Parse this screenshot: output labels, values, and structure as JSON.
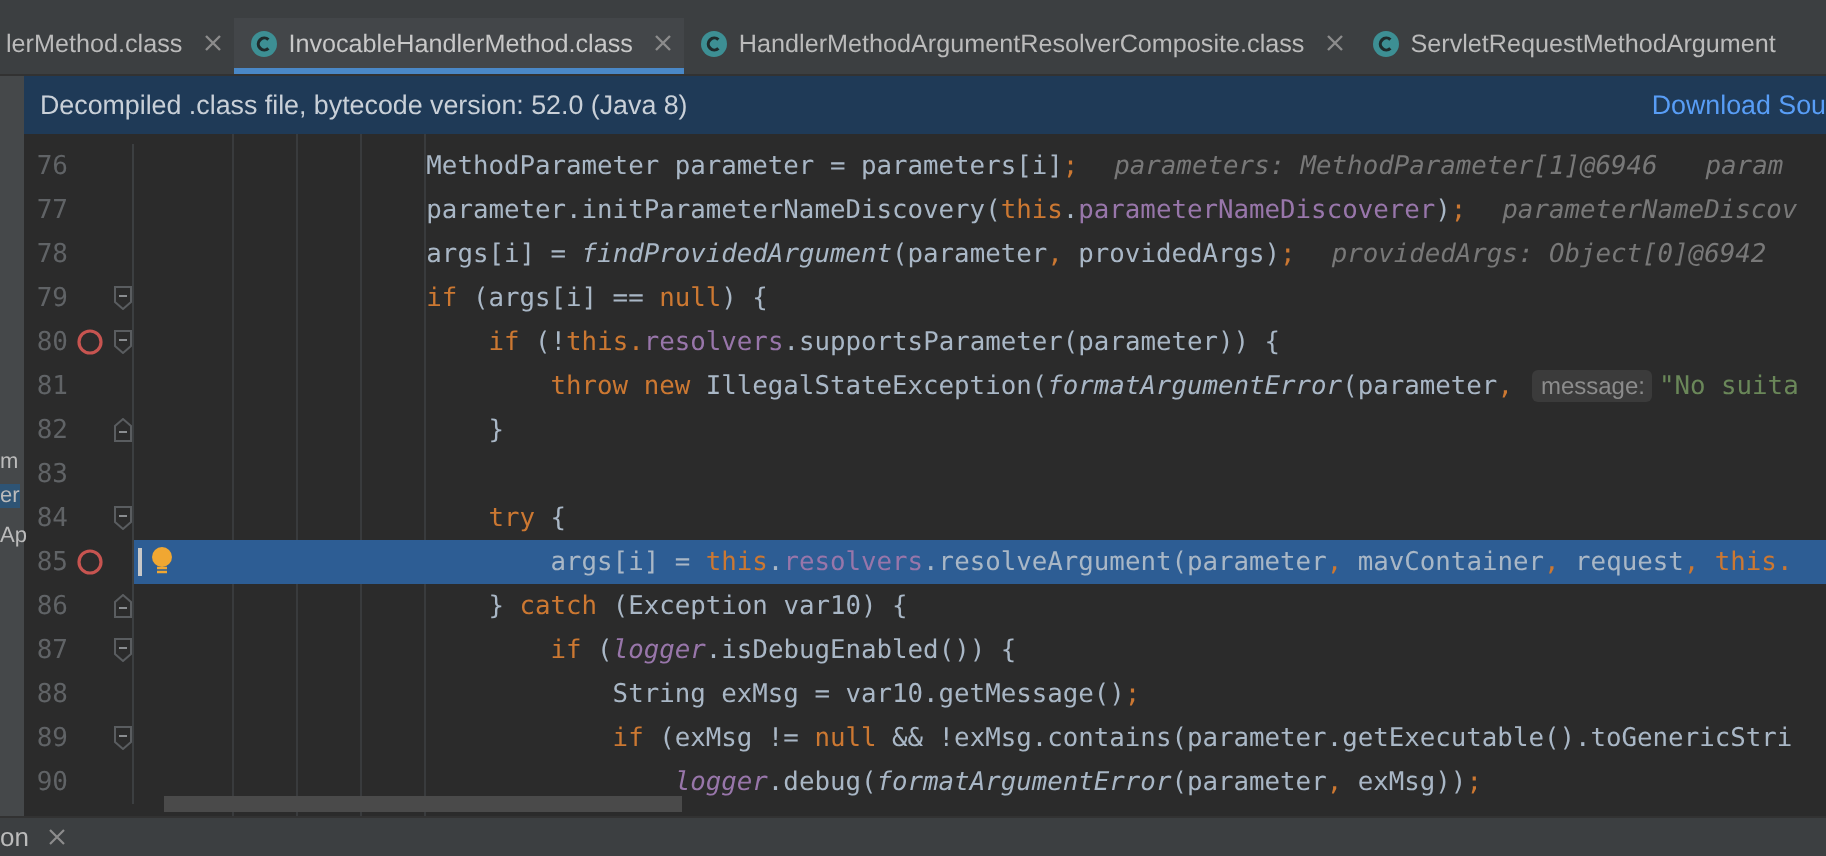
{
  "tabs": [
    {
      "label": "lerMethod.class",
      "selected": false,
      "closable": true,
      "icon": false
    },
    {
      "label": "InvocableHandlerMethod.class",
      "selected": true,
      "closable": true,
      "icon": true
    },
    {
      "label": "HandlerMethodArgumentResolverComposite.class",
      "selected": false,
      "closable": true,
      "icon": true
    },
    {
      "label": "ServletRequestMethodArgument",
      "selected": false,
      "closable": false,
      "icon": true
    }
  ],
  "notice": {
    "text": "Decompiled .class file, bytecode version: 52.0 (Java 8)",
    "link": "Download Sou"
  },
  "side_panel": {
    "fragments": [
      "m",
      "er",
      "Ap"
    ]
  },
  "editor": {
    "lines": [
      {
        "number": "76",
        "breakpoint": false,
        "fold_open": false,
        "fold_close": false,
        "current": false,
        "segments": [
          {
            "kind": "code",
            "tokens": [
              {
                "kind": "plain",
                "text": "                MethodParameter parameter = parameters[i]"
              },
              {
                "kind": "keyword",
                "text": ";"
              }
            ]
          },
          {
            "kind": "value_hint",
            "text": "parameters: MethodParameter[1]@6946"
          },
          {
            "kind": "value_hint",
            "text": "param"
          }
        ]
      },
      {
        "number": "77",
        "breakpoint": false,
        "fold_open": false,
        "fold_close": false,
        "current": false,
        "segments": [
          {
            "kind": "code",
            "tokens": [
              {
                "kind": "plain",
                "text": "                parameter.initParameterNameDiscovery("
              },
              {
                "kind": "keyword",
                "text": "this"
              },
              {
                "kind": "plain",
                "text": "."
              },
              {
                "kind": "field",
                "text": "parameterNameDiscoverer"
              },
              {
                "kind": "plain",
                "text": ")"
              },
              {
                "kind": "keyword",
                "text": ";"
              }
            ]
          },
          {
            "kind": "value_hint",
            "text": "parameterNameDiscov"
          }
        ]
      },
      {
        "number": "78",
        "breakpoint": false,
        "fold_open": false,
        "fold_close": false,
        "current": false,
        "segments": [
          {
            "kind": "code",
            "tokens": [
              {
                "kind": "plain",
                "text": "                args[i] = "
              },
              {
                "kind": "static",
                "text": "findProvidedArgument"
              },
              {
                "kind": "plain",
                "text": "(parameter"
              },
              {
                "kind": "keyword",
                "text": ","
              },
              {
                "kind": "plain",
                "text": " providedArgs)"
              },
              {
                "kind": "keyword",
                "text": ";"
              }
            ]
          },
          {
            "kind": "value_hint",
            "text": "providedArgs: Object[0]@6942"
          }
        ]
      },
      {
        "number": "79",
        "breakpoint": false,
        "fold_open": true,
        "fold_close": false,
        "current": false,
        "segments": [
          {
            "kind": "code",
            "tokens": [
              {
                "kind": "keyword",
                "text": "                if"
              },
              {
                "kind": "plain",
                "text": " (args[i] == "
              },
              {
                "kind": "keyword",
                "text": "null"
              },
              {
                "kind": "plain",
                "text": ") {"
              }
            ]
          }
        ]
      },
      {
        "number": "80",
        "breakpoint": true,
        "fold_open": true,
        "fold_close": false,
        "current": false,
        "segments": [
          {
            "kind": "code",
            "tokens": [
              {
                "kind": "keyword",
                "text": "                    if"
              },
              {
                "kind": "plain",
                "text": " (!"
              },
              {
                "kind": "keyword",
                "text": "this."
              },
              {
                "kind": "field",
                "text": "resolvers"
              },
              {
                "kind": "plain",
                "text": ".supportsParameter(parameter)) {"
              }
            ]
          }
        ]
      },
      {
        "number": "81",
        "breakpoint": false,
        "fold_open": false,
        "fold_close": false,
        "current": false,
        "segments": [
          {
            "kind": "code",
            "tokens": [
              {
                "kind": "keyword",
                "text": "                        throw new"
              },
              {
                "kind": "plain",
                "text": " IllegalStateException("
              },
              {
                "kind": "static",
                "text": "formatArgumentError"
              },
              {
                "kind": "plain",
                "text": "(parameter"
              },
              {
                "kind": "keyword",
                "text": ","
              }
            ]
          },
          {
            "kind": "param_hint",
            "text": "message:"
          },
          {
            "kind": "code",
            "tokens": [
              {
                "kind": "string",
                "text": "\"No suita"
              }
            ]
          }
        ]
      },
      {
        "number": "82",
        "breakpoint": false,
        "fold_open": false,
        "fold_close": true,
        "current": false,
        "segments": [
          {
            "kind": "code",
            "tokens": [
              {
                "kind": "plain",
                "text": "                    }"
              }
            ]
          }
        ]
      },
      {
        "number": "83",
        "breakpoint": false,
        "fold_open": false,
        "fold_close": false,
        "current": false
      },
      {
        "number": "84",
        "breakpoint": false,
        "fold_open": true,
        "fold_close": false,
        "current": false,
        "segments": [
          {
            "kind": "code",
            "tokens": [
              {
                "kind": "keyword",
                "text": "                    try"
              },
              {
                "kind": "plain",
                "text": " {"
              }
            ]
          }
        ]
      },
      {
        "number": "85",
        "breakpoint": true,
        "fold_open": false,
        "fold_close": false,
        "current": true,
        "bulb": true,
        "segments": [
          {
            "kind": "code",
            "tokens": [
              {
                "kind": "plain",
                "text": "                        args[i] = "
              },
              {
                "kind": "keyword",
                "text": "this"
              },
              {
                "kind": "plain",
                "text": "."
              },
              {
                "kind": "field",
                "text": "resolvers"
              },
              {
                "kind": "plain",
                "text": ".resolveArgument(parameter"
              },
              {
                "kind": "keyword",
                "text": ","
              },
              {
                "kind": "plain",
                "text": " mavContainer"
              },
              {
                "kind": "keyword",
                "text": ","
              },
              {
                "kind": "plain",
                "text": " request"
              },
              {
                "kind": "keyword",
                "text": ","
              },
              {
                "kind": "keyword",
                "text": " this."
              }
            ]
          }
        ]
      },
      {
        "number": "86",
        "breakpoint": false,
        "fold_open": false,
        "fold_close": true,
        "current": false,
        "segments": [
          {
            "kind": "code",
            "tokens": [
              {
                "kind": "plain",
                "text": "                    } "
              },
              {
                "kind": "keyword",
                "text": "catch"
              },
              {
                "kind": "plain",
                "text": " (Exception var10) {"
              }
            ]
          }
        ]
      },
      {
        "number": "87",
        "breakpoint": false,
        "fold_open": true,
        "fold_close": false,
        "current": false,
        "segments": [
          {
            "kind": "code",
            "tokens": [
              {
                "kind": "keyword",
                "text": "                        if"
              },
              {
                "kind": "plain",
                "text": " ("
              },
              {
                "kind": "static_field",
                "text": "logger"
              },
              {
                "kind": "plain",
                "text": ".isDebugEnabled()) {"
              }
            ]
          }
        ]
      },
      {
        "number": "88",
        "breakpoint": false,
        "fold_open": false,
        "fold_close": false,
        "current": false,
        "segments": [
          {
            "kind": "code",
            "tokens": [
              {
                "kind": "plain",
                "text": "                            String exMsg = var10.getMessage()"
              },
              {
                "kind": "keyword",
                "text": ";"
              }
            ]
          }
        ]
      },
      {
        "number": "89",
        "breakpoint": false,
        "fold_open": true,
        "fold_close": false,
        "current": false,
        "segments": [
          {
            "kind": "code",
            "tokens": [
              {
                "kind": "keyword",
                "text": "                            if"
              },
              {
                "kind": "plain",
                "text": " (exMsg != "
              },
              {
                "kind": "keyword",
                "text": "null"
              },
              {
                "kind": "plain",
                "text": " && !exMsg.contains(parameter.getExecutable().toGenericStri"
              }
            ]
          }
        ]
      },
      {
        "number": "90",
        "breakpoint": false,
        "fold_open": false,
        "fold_close": false,
        "current": false,
        "segments": [
          {
            "kind": "code",
            "tokens": [
              {
                "kind": "static_field",
                "text": "                                logger"
              },
              {
                "kind": "plain",
                "text": ".debug("
              },
              {
                "kind": "static",
                "text": "formatArgumentError"
              },
              {
                "kind": "plain",
                "text": "(parameter"
              },
              {
                "kind": "keyword",
                "text": ","
              },
              {
                "kind": "plain",
                "text": " exMsg))"
              },
              {
                "kind": "keyword",
                "text": ";"
              }
            ]
          }
        ]
      }
    ]
  },
  "bottom_panel": {
    "tab": "on"
  }
}
